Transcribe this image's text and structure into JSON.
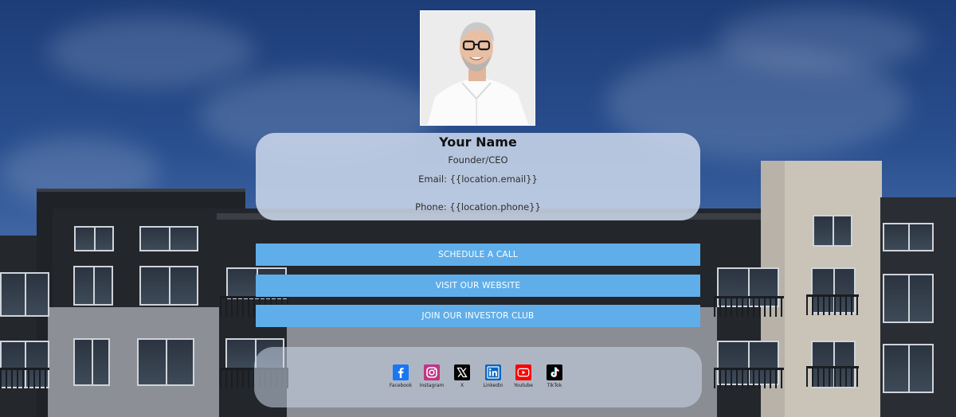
{
  "profile": {
    "avatar_alt": "avatar-photo",
    "name": "Your Name",
    "role": "Founder/CEO",
    "email": "Email: {{location.email}}",
    "phone": "Phone: {{location.phone}}"
  },
  "buttons": {
    "schedule": "SCHEDULE A CALL",
    "website": "VISIT OUR WEBSITE",
    "investor": "JOIN OUR INVESTOR CLUB"
  },
  "social": [
    {
      "label": "Facebook",
      "icon": "facebook-icon",
      "color": "#1877f2"
    },
    {
      "label": "Instagram",
      "icon": "instagram-icon",
      "color": "#c13584"
    },
    {
      "label": "X",
      "icon": "x-icon",
      "color": "#000000"
    },
    {
      "label": "Linkedin",
      "icon": "linkedin-icon",
      "color": "#0a66c2"
    },
    {
      "label": "Youtube",
      "icon": "youtube-icon",
      "color": "#ff0000"
    },
    {
      "label": "TikTok",
      "icon": "tiktok-icon",
      "color": "#000000"
    }
  ],
  "colors": {
    "button": "#5faeea",
    "card": "#cdd8eb",
    "sky": "#2a4f8e"
  }
}
